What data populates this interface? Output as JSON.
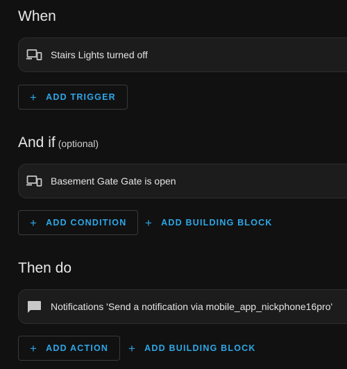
{
  "sections": {
    "when": {
      "title": "When",
      "card": {
        "icon": "device-icon",
        "label": "Stairs Lights turned off"
      },
      "add_trigger": {
        "plus": "+",
        "label": "ADD TRIGGER"
      }
    },
    "and_if": {
      "title": "And if",
      "optional": "(optional)",
      "card": {
        "icon": "device-icon",
        "label": "Basement Gate Gate is open"
      },
      "add_condition": {
        "plus": "+",
        "label": "ADD CONDITION"
      },
      "add_building_block": {
        "plus": "+",
        "label": "ADD BUILDING BLOCK"
      }
    },
    "then_do": {
      "title": "Then do",
      "card": {
        "icon": "message-icon",
        "label": "Notifications 'Send a notification via mobile_app_nickphone16pro'"
      },
      "add_action": {
        "plus": "+",
        "label": "ADD ACTION"
      },
      "add_building_block": {
        "plus": "+",
        "label": "ADD BUILDING BLOCK"
      }
    }
  },
  "colors": {
    "background": "#111111",
    "card": "#1c1c1c",
    "accent": "#2ea7e8",
    "icon": "#c8c8c8"
  }
}
